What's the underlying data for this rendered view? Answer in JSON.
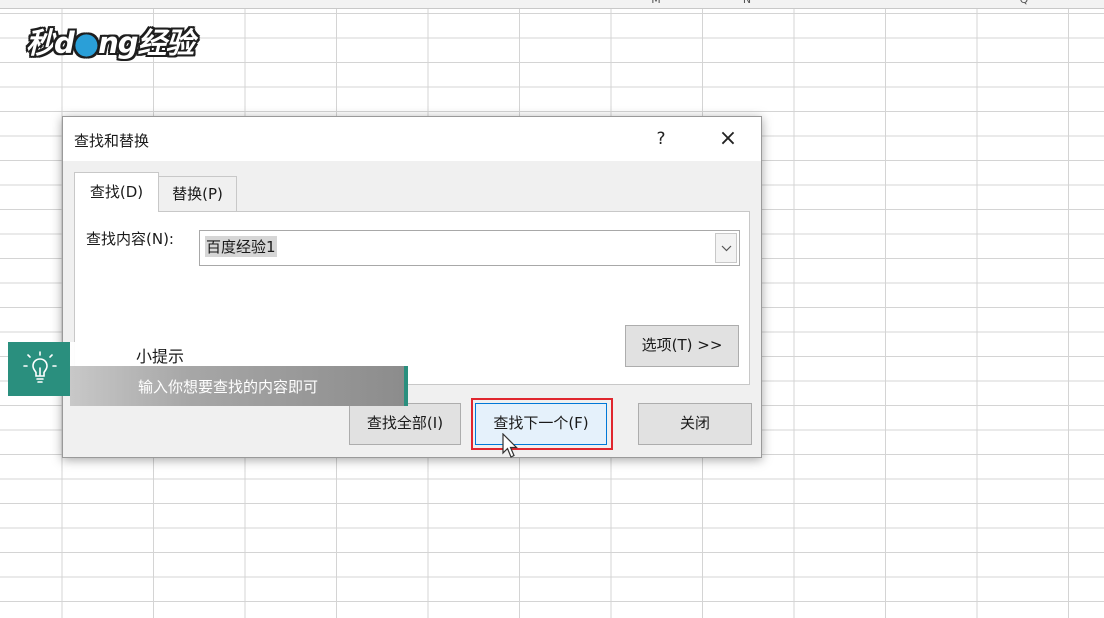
{
  "spreadsheet": {
    "column_letters": [
      "M",
      "N",
      "Q"
    ]
  },
  "watermark": {
    "part1": "秒",
    "part2": "d",
    "part3": "ng经验"
  },
  "dialog": {
    "title": "查找和替换",
    "help_label": "?",
    "close_label": "×",
    "tabs": [
      {
        "label": "查找(D)",
        "active": true
      },
      {
        "label": "替换(P)",
        "active": false
      }
    ],
    "find_label": "查找内容(N):",
    "find_value": "百度经验1",
    "options_button": "选项(T) >>",
    "find_all_button": "查找全部(I)",
    "find_next_button": "查找下一个(F)",
    "close_button": "关闭"
  },
  "tip": {
    "title": "小提示",
    "body": "输入你想要查找的内容即可"
  },
  "colors": {
    "accent": "#2a8f7e",
    "highlight": "#e0262e",
    "focus": "#0078d7"
  }
}
